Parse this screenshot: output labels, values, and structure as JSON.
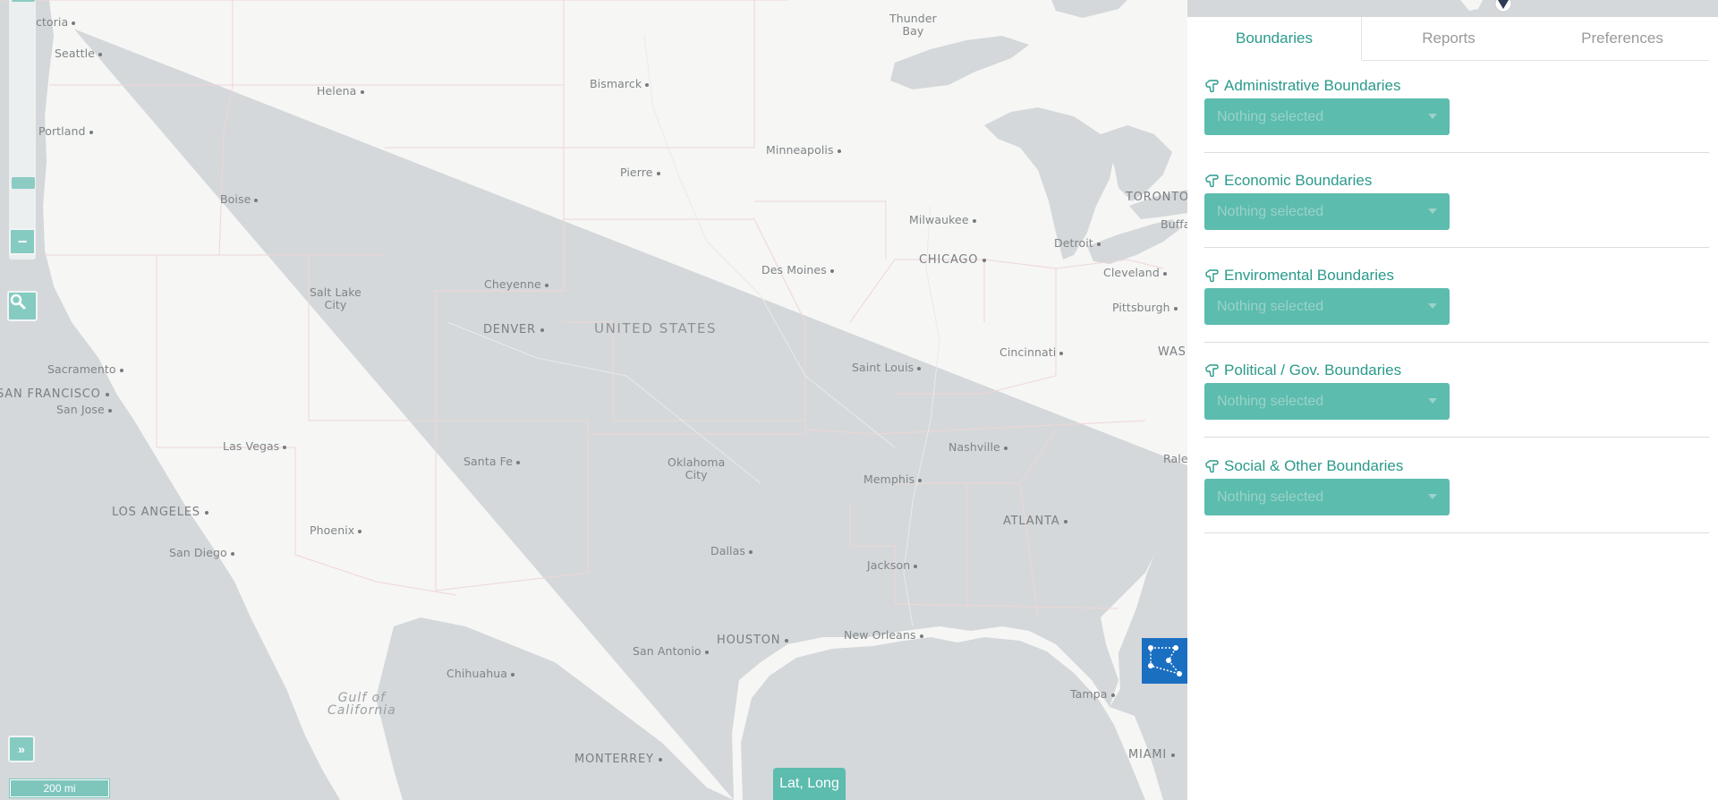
{
  "map": {
    "country_label": "UNITED STATES",
    "sea_label": "Gulf of\nCalifornia",
    "cities": [
      {
        "name": "Victoria"
      },
      {
        "name": "Seattle"
      },
      {
        "name": "Portland"
      },
      {
        "name": "Helena"
      },
      {
        "name": "Boise"
      },
      {
        "name": "Bismarck"
      },
      {
        "name": "Pierre"
      },
      {
        "name": "Minneapolis"
      },
      {
        "name": "Thunder\nBay"
      },
      {
        "name": "Salt Lake\nCity"
      },
      {
        "name": "Cheyenne"
      },
      {
        "name": "DENVER"
      },
      {
        "name": "Sacramento"
      },
      {
        "name": "SAN FRANCISCO"
      },
      {
        "name": "San Jose"
      },
      {
        "name": "Las Vegas"
      },
      {
        "name": "LOS ANGELES"
      },
      {
        "name": "San Diego"
      },
      {
        "name": "Phoenix"
      },
      {
        "name": "Santa Fe"
      },
      {
        "name": "Oklahoma\nCity"
      },
      {
        "name": "Dallas"
      },
      {
        "name": "HOUSTON"
      },
      {
        "name": "San Antonio"
      },
      {
        "name": "Chihuahua"
      },
      {
        "name": "MONTERREY"
      },
      {
        "name": "Des Moines"
      },
      {
        "name": "Milwaukee"
      },
      {
        "name": "CHICAGO"
      },
      {
        "name": "Detroit"
      },
      {
        "name": "TORONTO"
      },
      {
        "name": "Buffa"
      },
      {
        "name": "Cleveland"
      },
      {
        "name": "Pittsburgh"
      },
      {
        "name": "WAS"
      },
      {
        "name": "Cincinnati"
      },
      {
        "name": "Saint Louis"
      },
      {
        "name": "Nashville"
      },
      {
        "name": "Memphis"
      },
      {
        "name": "Rale"
      },
      {
        "name": "ATLANTA"
      },
      {
        "name": "Jackson"
      },
      {
        "name": "New Orleans"
      },
      {
        "name": "Tampa"
      },
      {
        "name": "MIAMI"
      }
    ],
    "zoom_out_label": "−",
    "expand_label": "»",
    "scale_label": "200 mi",
    "latlong_label": "Lat, Long"
  },
  "panel": {
    "tabs": [
      {
        "label": "Boundaries",
        "active": true
      },
      {
        "label": "Reports",
        "active": false
      },
      {
        "label": "Preferences",
        "active": false
      }
    ],
    "sections": [
      {
        "title": "Administrative Boundaries",
        "placeholder": "Nothing selected"
      },
      {
        "title": "Economic Boundaries",
        "placeholder": "Nothing selected"
      },
      {
        "title": "Enviromental Boundaries",
        "placeholder": "Nothing selected"
      },
      {
        "title": "Political / Gov. Boundaries",
        "placeholder": "Nothing selected"
      },
      {
        "title": "Social & Other Boundaries",
        "placeholder": "Nothing selected"
      }
    ]
  },
  "colors": {
    "accent": "#5cbcae",
    "accent_text": "#2a9a8b",
    "land": "#f6f6f5",
    "water": "#d4d8da",
    "draw_button": "#1b6fc1"
  }
}
